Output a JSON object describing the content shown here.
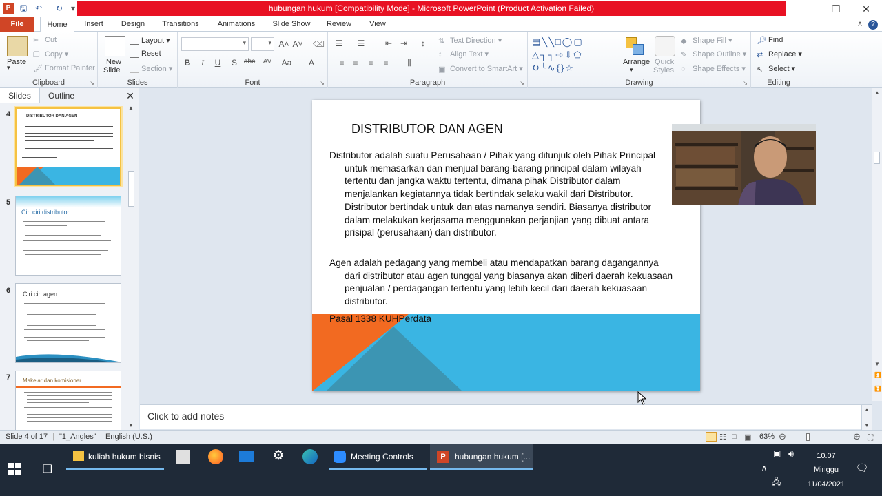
{
  "window": {
    "title": "hubungan hukum [Compatibility Mode] - Microsoft PowerPoint (Product Activation Failed)"
  },
  "tabs": [
    "File",
    "Home",
    "Insert",
    "Design",
    "Transitions",
    "Animations",
    "Slide Show",
    "Review",
    "View"
  ],
  "ribbon": {
    "clipboard": {
      "label": "Clipboard",
      "paste": "Paste",
      "cut": "Cut",
      "copy": "Copy",
      "format_painter": "Format Painter"
    },
    "slides": {
      "label": "Slides",
      "new_slide_1": "New",
      "new_slide_2": "Slide",
      "layout": "Layout",
      "reset": "Reset",
      "section": "Section"
    },
    "font": {
      "label": "Font"
    },
    "paragraph": {
      "label": "Paragraph",
      "text_direction": "Text Direction",
      "align_text": "Align Text",
      "convert_smartart": "Convert to SmartArt"
    },
    "drawing": {
      "label": "Drawing",
      "arrange": "Arrange",
      "quick_styles_1": "Quick",
      "quick_styles_2": "Styles",
      "shape_fill": "Shape Fill",
      "shape_outline": "Shape Outline",
      "shape_effects": "Shape Effects"
    },
    "editing": {
      "label": "Editing",
      "find": "Find",
      "replace": "Replace",
      "select": "Select"
    }
  },
  "pane": {
    "tab_slides": "Slides",
    "tab_outline": "Outline",
    "thumbs": [
      {
        "num": "4",
        "title": "DISTRIBUTOR DAN AGEN"
      },
      {
        "num": "5",
        "title": "Ciri ciri distributor"
      },
      {
        "num": "6",
        "title": "Ciri ciri agen"
      },
      {
        "num": "7",
        "title": "Makelar dan komisioner"
      }
    ]
  },
  "slide": {
    "title": "DISTRIBUTOR DAN AGEN",
    "para1": "Distributor adalah suatu Perusahaan / Pihak yang ditunjuk oleh Pihak Principal untuk memasarkan dan menjual barang-barang principal dalam wilayah tertentu dan jangka waktu tertentu, dimana pihak Distributor dalam menjalankan kegiatannya tidak bertindak selaku wakil dari Distributor. Distributor bertindak untuk dan atas namanya sendiri. Biasanya distributor dalam melakukan kerjasama menggunakan perjanjian yang dibuat antara prisipal (perusahaan) dan distributor.",
    "para2": "Agen adalah pedagang yang membeli atau mendapatkan barang dagangannya dari distributor atau agen tunggal yang biasanya akan diberi daerah kekuasaan penjualan / perdagangan tertentu yang lebih kecil dari daerah kekuasaan distributor.",
    "pasal": "Pasal 1338 KUHPerdata"
  },
  "notes_placeholder": "Click to add notes",
  "status": {
    "slide_info": "Slide 4 of 17",
    "theme": "\"1_Angles\"",
    "language": "English (U.S.)",
    "zoom": "63%"
  },
  "taskbar": {
    "items": [
      "kuliah hukum bisnis",
      "Meeting Controls",
      "hubungan hukum [..."
    ],
    "time": "10.07",
    "day": "Minggu",
    "date": "11/04/2021"
  },
  "colors": {
    "accent_blue": "#3ab5e3",
    "accent_orange": "#f26a21",
    "file_tab": "#d04526",
    "titlebar_red": "#e81123"
  }
}
